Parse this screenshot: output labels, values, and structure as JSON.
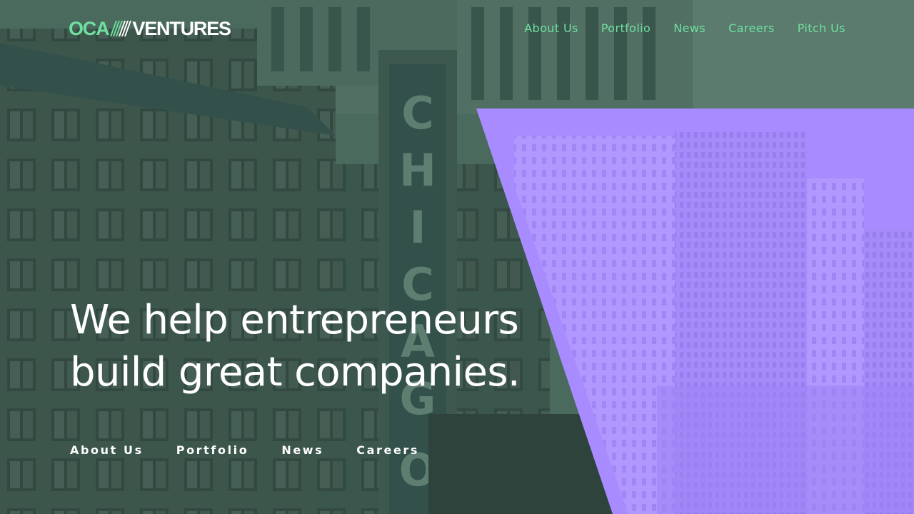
{
  "brand": {
    "logo_oca": "OCA",
    "logo_ventures": "VENTURES",
    "accent": "#6fe0a0",
    "purple": "#a88cff",
    "dark": "#2f433d"
  },
  "top_nav": {
    "items": [
      {
        "label": "About Us"
      },
      {
        "label": "Portfolio"
      },
      {
        "label": "News"
      },
      {
        "label": "Careers"
      },
      {
        "label": "Pitch Us"
      }
    ]
  },
  "hero": {
    "line1": "We help entrepreneurs",
    "line2": "build great companies."
  },
  "bottom_nav": {
    "items": [
      {
        "label": "About Us"
      },
      {
        "label": "Portfolio"
      },
      {
        "label": "News"
      },
      {
        "label": "Careers"
      }
    ]
  }
}
